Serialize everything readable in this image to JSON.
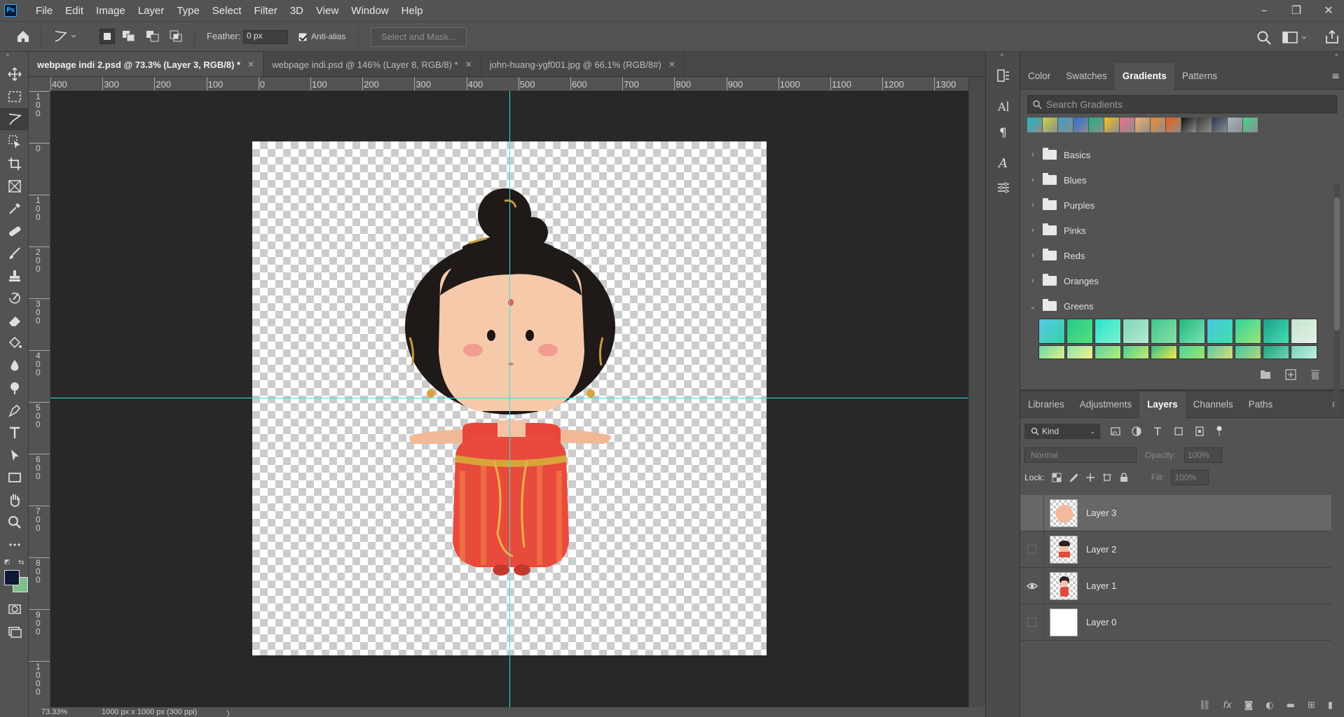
{
  "app": {
    "logo": "Ps"
  },
  "menu": [
    "File",
    "Edit",
    "Image",
    "Layer",
    "Type",
    "Select",
    "Filter",
    "3D",
    "View",
    "Window",
    "Help"
  ],
  "window_controls": {
    "minimize": "–",
    "restore": "❐",
    "close": "✕"
  },
  "options": {
    "feather_label": "Feather:",
    "feather_value": "0 px",
    "antialias_label": "Anti-alias",
    "antialias_checked": true,
    "select_mask_label": "Select and Mask..."
  },
  "tabs": [
    {
      "label": "webpage indi 2.psd @ 73.3% (Layer 3, RGB/8) *",
      "close": "✕",
      "active": true
    },
    {
      "label": "webpage indi.psd @ 146% (Layer 8, RGB/8) *",
      "close": "✕",
      "active": false
    },
    {
      "label": "john-huang-ygf001.jpg @ 66.1% (RGB/8#)",
      "close": "✕",
      "active": false
    }
  ],
  "ruler_top": [
    "400",
    "300",
    "200",
    "100",
    "0",
    "100",
    "200",
    "300",
    "400",
    "500",
    "600",
    "700",
    "800",
    "900",
    "1000",
    "1100",
    "1200",
    "1300"
  ],
  "ruler_left": [
    "1\n0\n0",
    "0",
    "1\n0\n0",
    "2\n0\n0",
    "3\n0\n0",
    "4\n0\n0",
    "5\n0\n0",
    "6\n0\n0",
    "7\n0\n0",
    "8\n0\n0",
    "9\n0\n0",
    "1\n0\n0\n0"
  ],
  "status": {
    "zoom": "73.33%",
    "doc_info": "1000 px x 1000 px (300 ppi)",
    "arrow": "〉"
  },
  "gradients_panel": {
    "tabs": [
      "Color",
      "Swatches",
      "Gradients",
      "Patterns"
    ],
    "active_tab": "Gradients",
    "search_placeholder": "Search Gradients",
    "recent_swatches": [
      "#1fb8c4",
      "#c9d247",
      "#3aa0c9",
      "#2c6fd1",
      "#19b37d",
      "#f7c21a",
      "#f26f8a",
      "#f6b26b",
      "#f38b2e",
      "#f25d11",
      "#111111",
      "#3b3b3b",
      "#2a3656",
      "#a8b5c6",
      "#44d68c"
    ],
    "folders": [
      "Basics",
      "Blues",
      "Purples",
      "Pinks",
      "Reds",
      "Oranges",
      "Greens"
    ],
    "greens_tiles": [
      [
        "#5ac8e8",
        "#32d3a4"
      ],
      [
        "#26c98a",
        "#52e07e"
      ],
      [
        "#28e3c8",
        "#7ef2d2"
      ],
      [
        "#7fd6b8",
        "#b4ead0"
      ],
      [
        "#3fc68f",
        "#8be0a3"
      ],
      [
        "#22b77a",
        "#7ce2b8"
      ],
      [
        "#49c6e0",
        "#3fe0a9"
      ],
      [
        "#2fd49c",
        "#9ee37a"
      ],
      [
        "#1b9e8a",
        "#44e0b1"
      ],
      [
        "#c6e4cf",
        "#e2f1e6"
      ],
      [
        "#6ad7a8",
        "#dff18c"
      ],
      [
        "#8ee0b0",
        "#f2f28a"
      ],
      [
        "#5fd0a0",
        "#b6ef7a"
      ],
      [
        "#4ecb8f",
        "#c3ea77"
      ],
      [
        "#34c08a",
        "#f0e84c"
      ],
      [
        "#4ad39b",
        "#9fe66c"
      ],
      [
        "#59c9a5",
        "#d6dd7c"
      ],
      [
        "#42c4a5",
        "#b5d77a"
      ],
      [
        "#1fa37f",
        "#71d2b8"
      ],
      [
        "#76d1c0",
        "#c3efe1"
      ]
    ]
  },
  "layers_panel": {
    "tabs": [
      "Libraries",
      "Adjustments",
      "Layers",
      "Channels",
      "Paths"
    ],
    "active_tab": "Layers",
    "kind_label": "Kind",
    "blend_mode": "Normal",
    "opacity_label": "Opacity:",
    "opacity_value": "100%",
    "lock_label": "Lock:",
    "fill_label": "Fill:",
    "fill_value": "100%",
    "layers": [
      {
        "name": "Layer 3",
        "visible": false,
        "selected": true
      },
      {
        "name": "Layer 2",
        "visible": false,
        "selected": false
      },
      {
        "name": "Layer 1",
        "visible": true,
        "selected": false
      },
      {
        "name": "Layer 0",
        "visible": false,
        "selected": false
      }
    ]
  },
  "colors": {
    "foreground": "#0e1a35",
    "background": "#7fbf8c",
    "guide": "#33e0e8",
    "panel_bg": "#535353"
  }
}
